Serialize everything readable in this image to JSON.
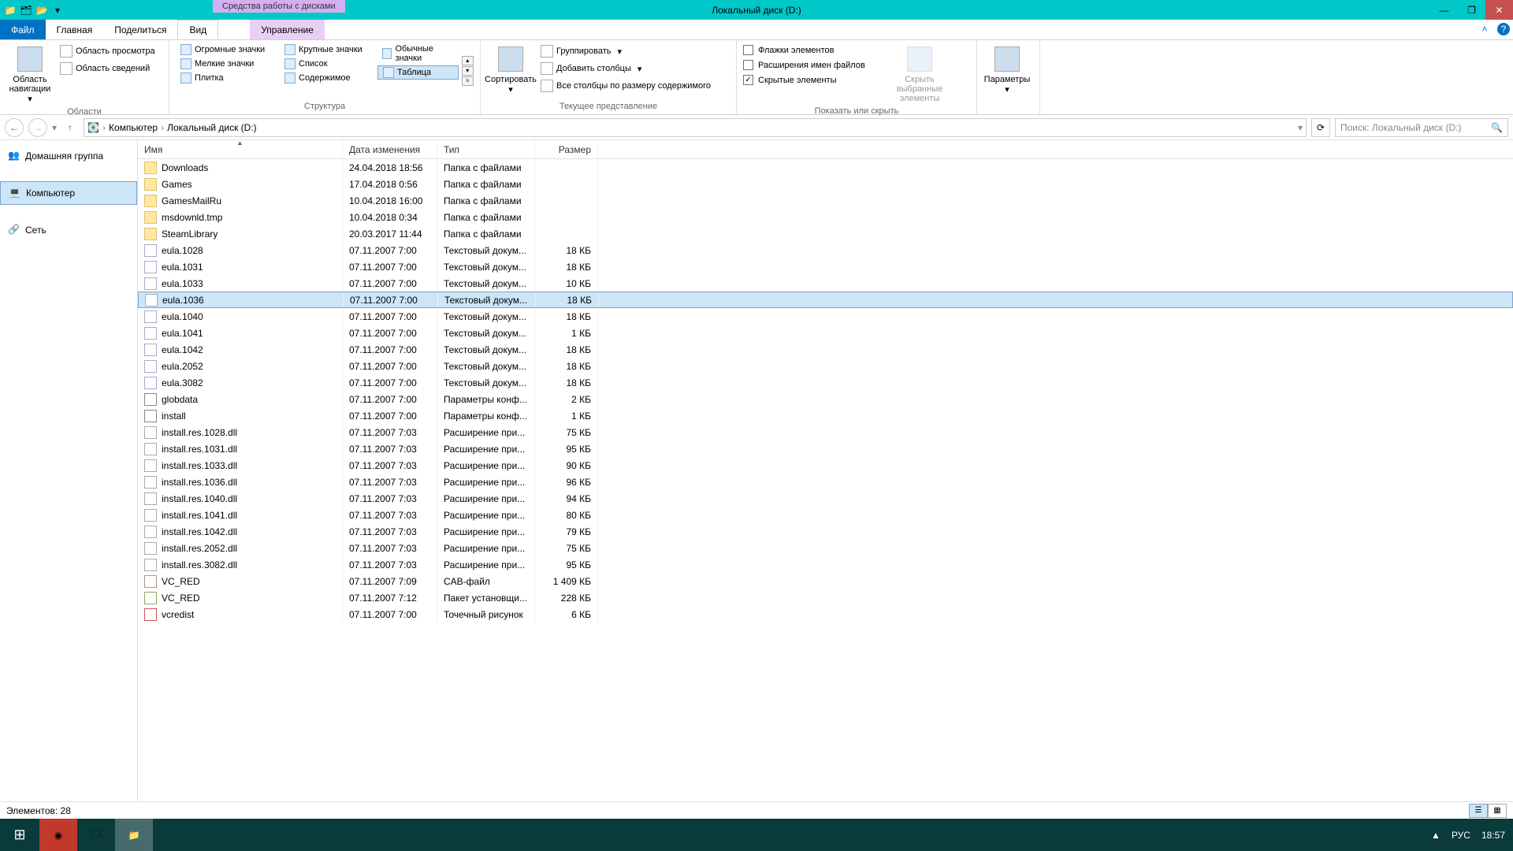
{
  "window": {
    "title": "Локальный диск (D:)",
    "contextual_tab_header": "Средства работы с дисками"
  },
  "tabs": {
    "file": "Файл",
    "home": "Главная",
    "share": "Поделиться",
    "view": "Вид",
    "manage": "Управление"
  },
  "ribbon": {
    "panes_group": "Области",
    "nav_pane_big": "Область навигации",
    "preview_pane": "Область просмотра",
    "details_pane": "Область сведений",
    "layout_group": "Структура",
    "extra_large": "Огромные значки",
    "large": "Крупные значки",
    "medium": "Обычные значки",
    "small": "Мелкие значки",
    "list": "Список",
    "tiles": "Плитка",
    "content": "Содержимое",
    "details": "Таблица",
    "current_view_group": "Текущее представление",
    "sort_by": "Сортировать",
    "group_by": "Группировать",
    "add_columns": "Добавить столбцы",
    "size_columns": "Все столбцы по размеру содержимого",
    "show_hide_group": "Показать или скрыть",
    "item_checkboxes": "Флажки элементов",
    "file_ext": "Расширения имен файлов",
    "hidden_items": "Скрытые элементы",
    "hide_selected": "Скрыть выбранные элементы",
    "options": "Параметры"
  },
  "breadcrumb": {
    "computer": "Компьютер",
    "drive": "Локальный диск (D:)"
  },
  "search": {
    "placeholder": "Поиск: Локальный диск (D:)"
  },
  "nav": {
    "homegroup": "Домашняя группа",
    "computer": "Компьютер",
    "network": "Сеть"
  },
  "columns": {
    "name": "Имя",
    "date": "Дата изменения",
    "type": "Тип",
    "size": "Размер"
  },
  "files": [
    {
      "name": "Downloads",
      "date": "24.04.2018 18:56",
      "type": "Папка с файлами",
      "size": "",
      "icon": "folder"
    },
    {
      "name": "Games",
      "date": "17.04.2018 0:56",
      "type": "Папка с файлами",
      "size": "",
      "icon": "folder"
    },
    {
      "name": "GamesMailRu",
      "date": "10.04.2018 16:00",
      "type": "Папка с файлами",
      "size": "",
      "icon": "folder"
    },
    {
      "name": "msdownld.tmp",
      "date": "10.04.2018 0:34",
      "type": "Папка с файлами",
      "size": "",
      "icon": "folder"
    },
    {
      "name": "SteamLibrary",
      "date": "20.03.2017 11:44",
      "type": "Папка с файлами",
      "size": "",
      "icon": "folder"
    },
    {
      "name": "eula.1028",
      "date": "07.11.2007 7:00",
      "type": "Текстовый докум...",
      "size": "18 КБ",
      "icon": "file"
    },
    {
      "name": "eula.1031",
      "date": "07.11.2007 7:00",
      "type": "Текстовый докум...",
      "size": "18 КБ",
      "icon": "file"
    },
    {
      "name": "eula.1033",
      "date": "07.11.2007 7:00",
      "type": "Текстовый докум...",
      "size": "10 КБ",
      "icon": "file"
    },
    {
      "name": "eula.1036",
      "date": "07.11.2007 7:00",
      "type": "Текстовый докум...",
      "size": "18 КБ",
      "icon": "file",
      "selected": true
    },
    {
      "name": "eula.1040",
      "date": "07.11.2007 7:00",
      "type": "Текстовый докум...",
      "size": "18 КБ",
      "icon": "file"
    },
    {
      "name": "eula.1041",
      "date": "07.11.2007 7:00",
      "type": "Текстовый докум...",
      "size": "1 КБ",
      "icon": "file"
    },
    {
      "name": "eula.1042",
      "date": "07.11.2007 7:00",
      "type": "Текстовый докум...",
      "size": "18 КБ",
      "icon": "file"
    },
    {
      "name": "eula.2052",
      "date": "07.11.2007 7:00",
      "type": "Текстовый докум...",
      "size": "18 КБ",
      "icon": "file"
    },
    {
      "name": "eula.3082",
      "date": "07.11.2007 7:00",
      "type": "Текстовый докум...",
      "size": "18 КБ",
      "icon": "file"
    },
    {
      "name": "globdata",
      "date": "07.11.2007 7:00",
      "type": "Параметры конф...",
      "size": "2 КБ",
      "icon": "cfg"
    },
    {
      "name": "install",
      "date": "07.11.2007 7:00",
      "type": "Параметры конф...",
      "size": "1 КБ",
      "icon": "cfg"
    },
    {
      "name": "install.res.1028.dll",
      "date": "07.11.2007 7:03",
      "type": "Расширение при...",
      "size": "75 КБ",
      "icon": "dll"
    },
    {
      "name": "install.res.1031.dll",
      "date": "07.11.2007 7:03",
      "type": "Расширение при...",
      "size": "95 КБ",
      "icon": "dll"
    },
    {
      "name": "install.res.1033.dll",
      "date": "07.11.2007 7:03",
      "type": "Расширение при...",
      "size": "90 КБ",
      "icon": "dll"
    },
    {
      "name": "install.res.1036.dll",
      "date": "07.11.2007 7:03",
      "type": "Расширение при...",
      "size": "96 КБ",
      "icon": "dll"
    },
    {
      "name": "install.res.1040.dll",
      "date": "07.11.2007 7:03",
      "type": "Расширение при...",
      "size": "94 КБ",
      "icon": "dll"
    },
    {
      "name": "install.res.1041.dll",
      "date": "07.11.2007 7:03",
      "type": "Расширение при...",
      "size": "80 КБ",
      "icon": "dll"
    },
    {
      "name": "install.res.1042.dll",
      "date": "07.11.2007 7:03",
      "type": "Расширение при...",
      "size": "79 КБ",
      "icon": "dll"
    },
    {
      "name": "install.res.2052.dll",
      "date": "07.11.2007 7:03",
      "type": "Расширение при...",
      "size": "75 КБ",
      "icon": "dll"
    },
    {
      "name": "install.res.3082.dll",
      "date": "07.11.2007 7:03",
      "type": "Расширение при...",
      "size": "95 КБ",
      "icon": "dll"
    },
    {
      "name": "VC_RED",
      "date": "07.11.2007 7:09",
      "type": "CAB-файл",
      "size": "1 409 КБ",
      "icon": "cab"
    },
    {
      "name": "VC_RED",
      "date": "07.11.2007 7:12",
      "type": "Пакет установщи...",
      "size": "228 КБ",
      "icon": "msi"
    },
    {
      "name": "vcredist",
      "date": "07.11.2007 7:00",
      "type": "Точечный рисунок",
      "size": "6 КБ",
      "icon": "bmp"
    }
  ],
  "status": {
    "items": "Элементов: 28"
  },
  "tray": {
    "lang": "РУС",
    "time": "18:57",
    "arrow": "▲"
  }
}
